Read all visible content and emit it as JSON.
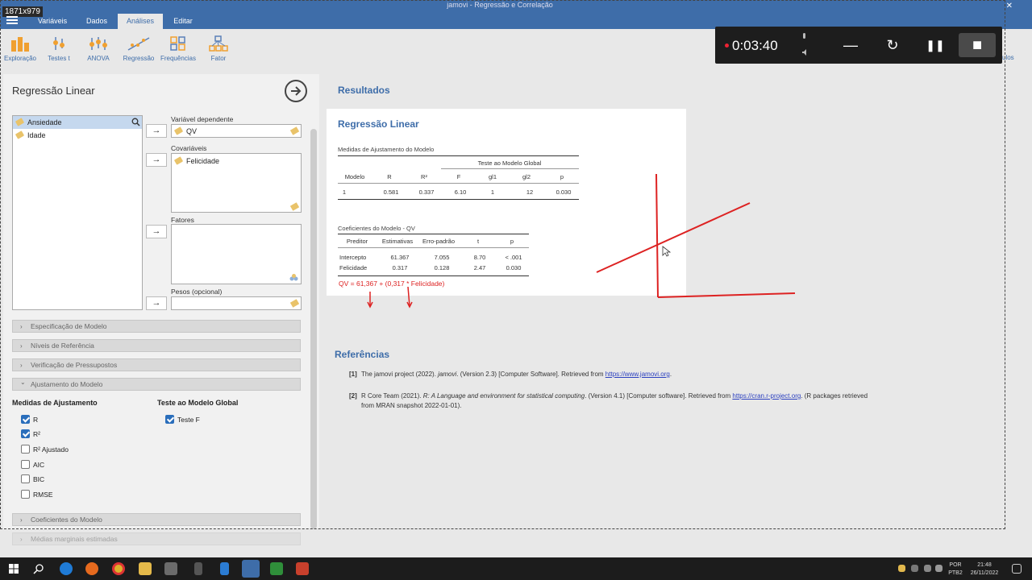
{
  "window": {
    "dimension_badge": "1871x979",
    "title": "jamovi - Regressão e Correlação",
    "close_glyph": "✕"
  },
  "menu": {
    "tabs": [
      {
        "label": "Variáveis"
      },
      {
        "label": "Dados"
      },
      {
        "label": "Análises"
      },
      {
        "label": "Editar"
      }
    ]
  },
  "ribbon": {
    "items": [
      {
        "label": "Exploração",
        "icon": "exploration-icon"
      },
      {
        "label": "Testes t",
        "icon": "ttest-icon"
      },
      {
        "label": "ANOVA",
        "icon": "anova-icon"
      },
      {
        "label": "Regressão",
        "icon": "regression-icon"
      },
      {
        "label": "Frequências",
        "icon": "frequencies-icon"
      },
      {
        "label": "Fator",
        "icon": "factor-icon"
      }
    ],
    "cut_off_label": "ulos"
  },
  "recorder": {
    "time": "0:03:40",
    "minimize_glyph": "—",
    "restart_glyph": "↻",
    "pause_glyph": "❚❚",
    "stop_glyph": "■"
  },
  "analysis": {
    "title": "Regressão Linear",
    "variables": [
      {
        "name": "Ansiedade",
        "selected": true
      },
      {
        "name": "Idade",
        "selected": false
      }
    ],
    "arrow_glyph": "→",
    "dependent_label": "Variável dependente",
    "dependent_value": "QV",
    "covariates_label": "Covariáveis",
    "covariate_value": "Felicidade",
    "factors_label": "Fatores",
    "weights_label": "Pesos (opcional)",
    "sections": [
      {
        "label": "Especificação de Modelo",
        "chevron": "›"
      },
      {
        "label": "Níveis de Referência",
        "chevron": "›"
      },
      {
        "label": "Verificação de Pressupostos",
        "chevron": "›"
      },
      {
        "label": "Ajustamento do Modelo",
        "chevron": "⌄"
      }
    ],
    "fit_measures_title": "Medidas de Ajustamento",
    "global_test_title": "Teste ao Modelo Global",
    "fit_options": [
      {
        "label": "R",
        "checked": true
      },
      {
        "label": "R²",
        "checked": true
      },
      {
        "label": "R² Ajustado",
        "checked": false
      },
      {
        "label": "AIC",
        "checked": false
      },
      {
        "label": "BIC",
        "checked": false
      },
      {
        "label": "RMSE",
        "checked": false
      }
    ],
    "global_options": [
      {
        "label": "Teste F",
        "checked": true
      }
    ],
    "bottom_sections": [
      {
        "label": "Coeficientes do Modelo",
        "chevron": "›"
      },
      {
        "label": "Médias marginais estimadas",
        "chevron": "›"
      }
    ]
  },
  "results": {
    "title": "Resultados",
    "regression_title": "Regressão Linear",
    "fit_table": {
      "title": "Medidas de Ajustamento do Modelo",
      "super_header": "Teste ao Modelo Global",
      "headers": [
        "Modelo",
        "R",
        "R²",
        "F",
        "gl1",
        "gl2",
        "p"
      ],
      "row": [
        "1",
        "0.581",
        "0.337",
        "6.10",
        "1",
        "12",
        "0.030"
      ]
    },
    "coef_table": {
      "title": "Coeficientes do Modelo - QV",
      "headers": [
        "Preditor",
        "Estimativas",
        "Erro-padrão",
        "t",
        "p"
      ],
      "rows": [
        [
          "Intercepto",
          "61.367",
          "7.055",
          "8.70",
          "< .001"
        ],
        [
          "Felicidade",
          "0.317",
          "0.128",
          "2.47",
          "0.030"
        ]
      ]
    },
    "formula": "QV = 61,367 + (0,317 * Felicidade)",
    "references_title": "Referências",
    "references": [
      {
        "num": "[1]",
        "pre": "The jamovi project (2022). ",
        "italic": "jamovi",
        "post": ". (Version 2.3) [Computer Software]. Retrieved from ",
        "link": "https://www.jamovi.org",
        "tail": "."
      },
      {
        "num": "[2]",
        "pre": "R Core Team (2021). ",
        "italic": "R: A Language and environment for statistical computing",
        "post": ". (Version 4.1) [Computer software]. Retrieved from ",
        "link": "https://cran.r-project.org",
        "tail": ". (R packages retrieved from MRAN snapshot 2022-01-01)."
      }
    ]
  },
  "taskbar": {
    "language": "POR",
    "layout": "PTB2",
    "time": "21:48",
    "date": "26/11/2022"
  },
  "colors": {
    "header_blue": "#3e6da9",
    "annotation_red": "#dd2222",
    "checkbox_blue": "#2a6ebb"
  }
}
